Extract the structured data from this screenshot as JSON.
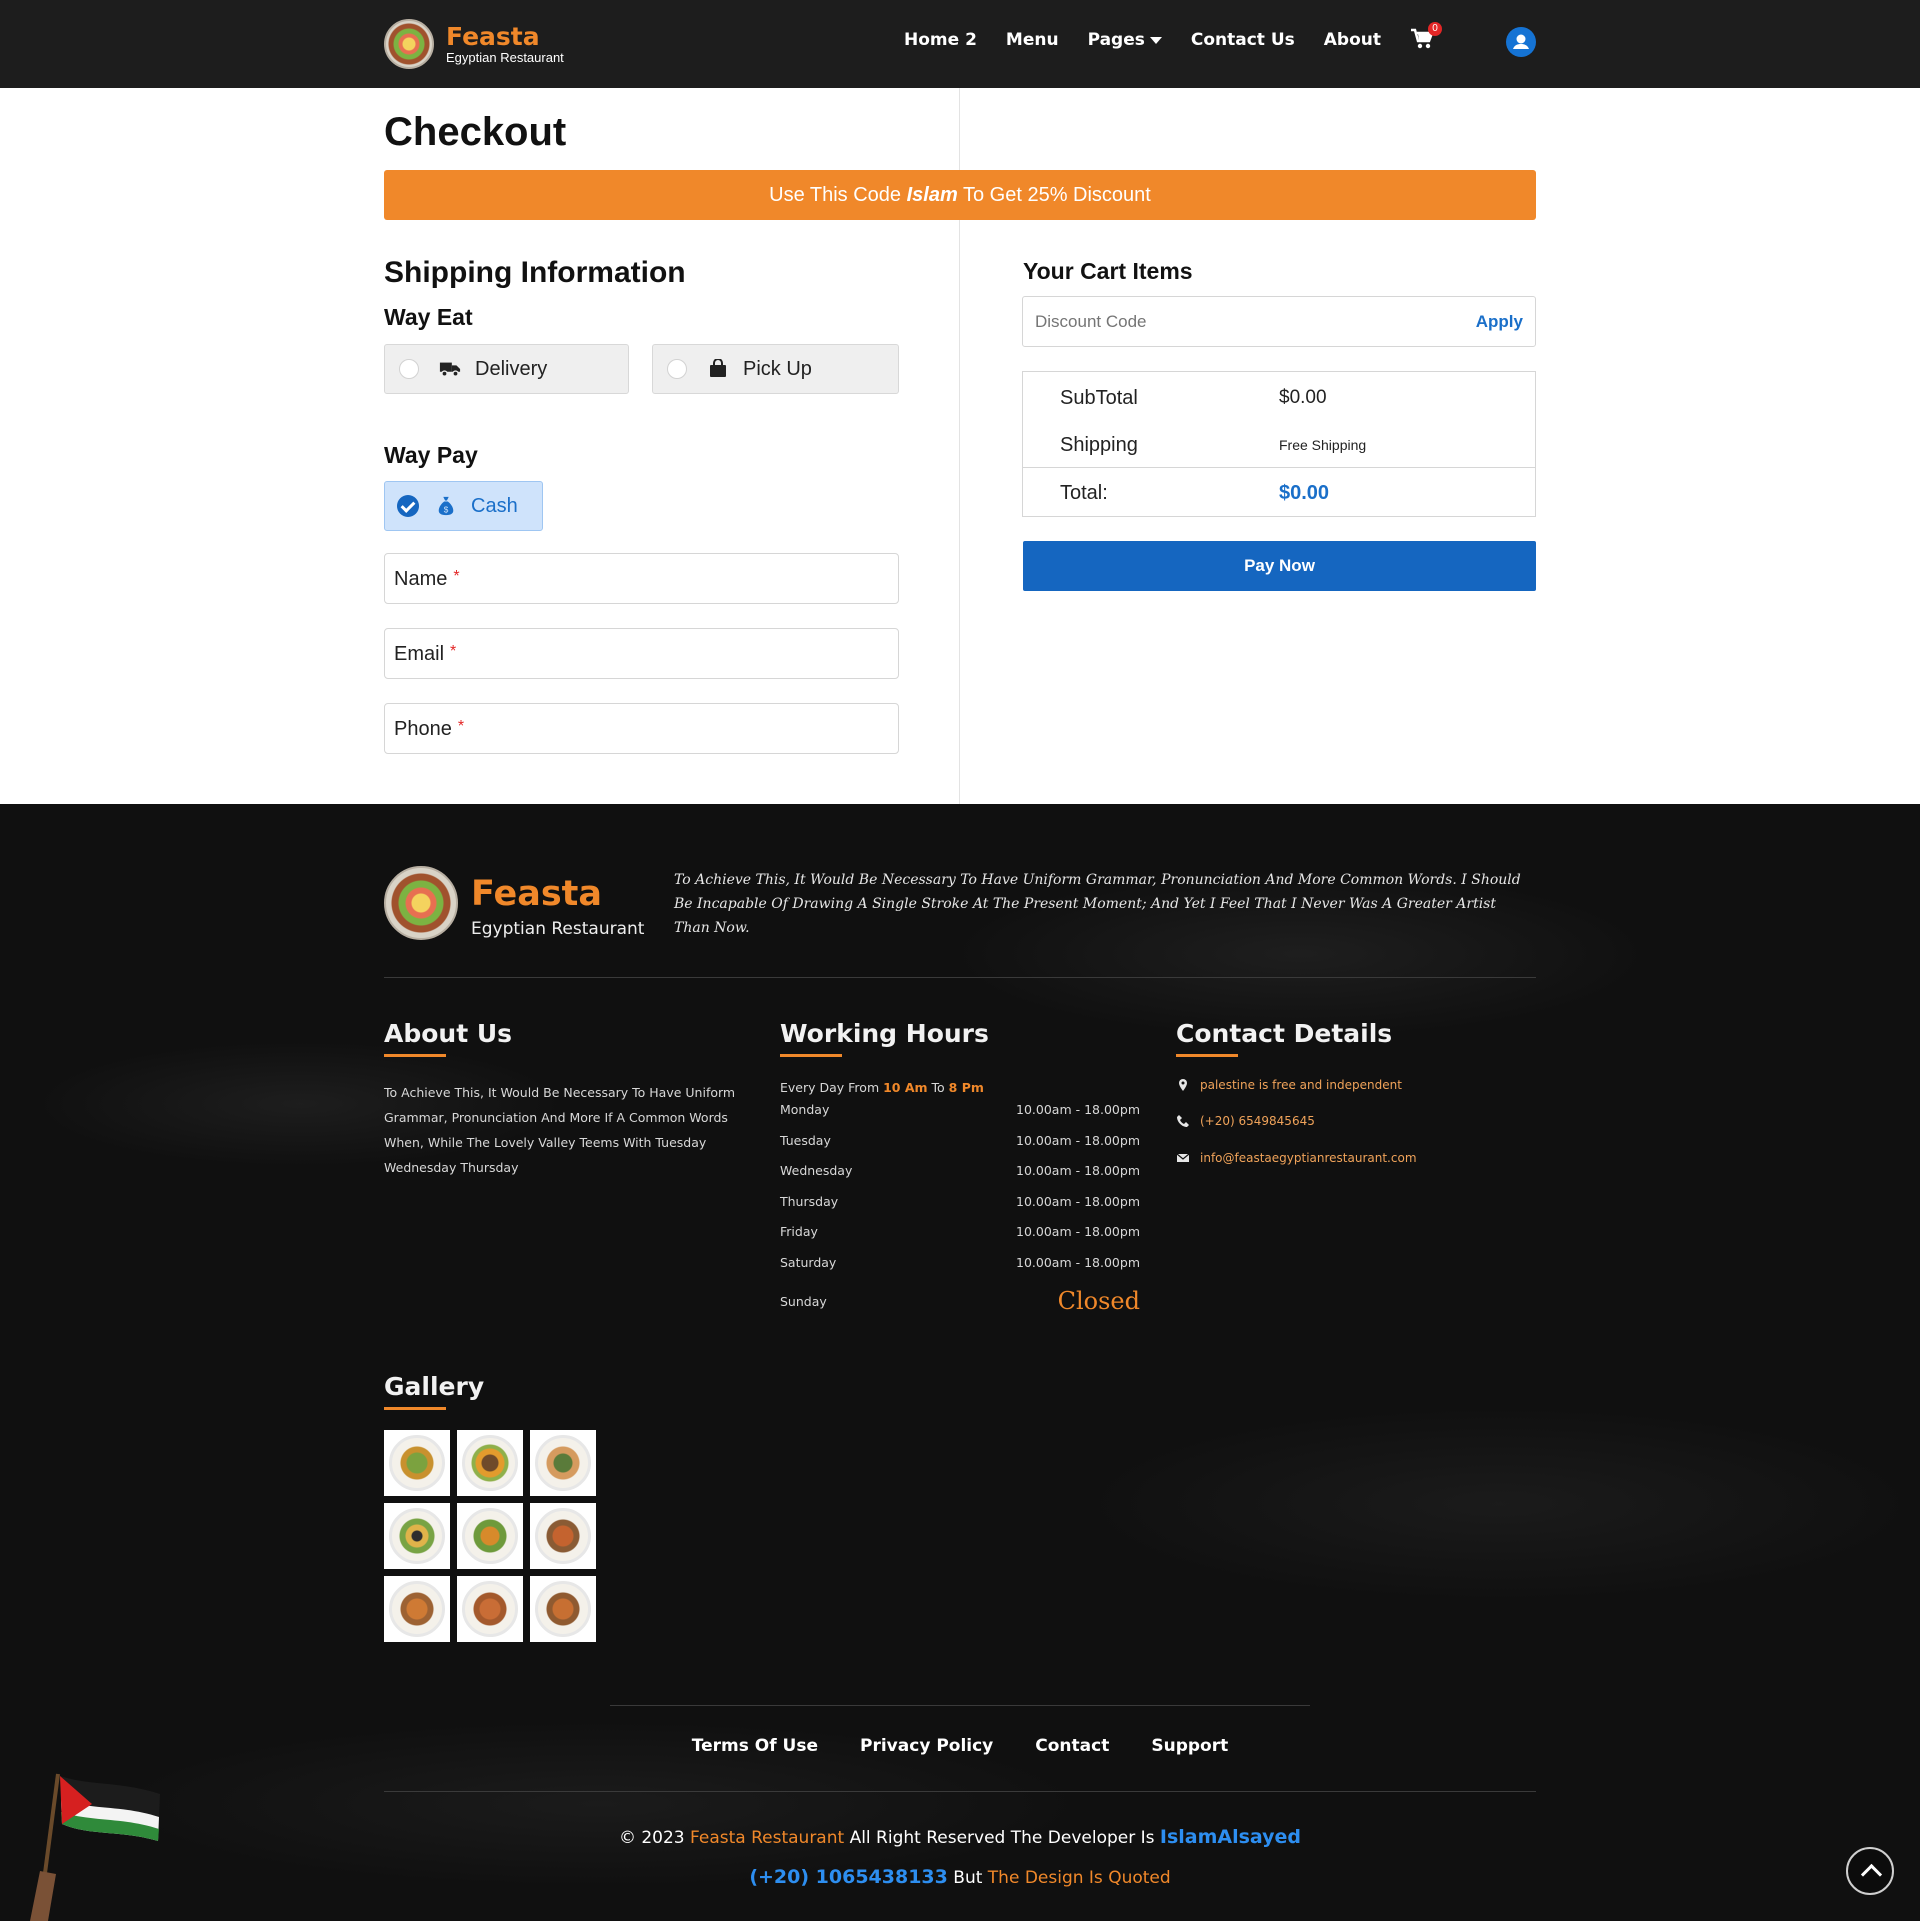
{
  "brand": {
    "name": "Feasta",
    "subtitle": "Egyptian Restaurant"
  },
  "nav": {
    "links": [
      "Home 2",
      "Menu",
      "Pages",
      "Contact Us",
      "About"
    ],
    "cart_count": "0"
  },
  "page": {
    "title": "Checkout",
    "promo": {
      "before": "Use This Code ",
      "code": "Islam",
      "after": " To Get 25% Discount"
    }
  },
  "shipping": {
    "heading": "Shipping Information",
    "way_eat_label": "Way Eat",
    "eat_options": [
      "Delivery",
      "Pick Up"
    ],
    "way_pay_label": "Way Pay",
    "pay_option": "Cash",
    "fields": [
      {
        "label": "Name",
        "required": "*"
      },
      {
        "label": "Email",
        "required": "*"
      },
      {
        "label": "Phone",
        "required": "*"
      }
    ]
  },
  "cart": {
    "title": "Your Cart Items",
    "discount_placeholder": "Discount Code",
    "apply_label": "Apply",
    "subtotal_label": "SubTotal",
    "subtotal_value": "$0.00",
    "shipping_label": "Shipping",
    "shipping_value": "Free Shipping",
    "total_label": "Total:",
    "total_value": "$0.00",
    "pay_label": "Pay Now"
  },
  "footer": {
    "brand_name": "Feasta",
    "brand_sub": "Egyptian Restaurant",
    "intro": "To Achieve This, It Would Be Necessary To Have Uniform Grammar, Pronunciation And More Common Words. I Should Be Incapable Of Drawing A Single Stroke At The Present Moment; And Yet I Feel That I Never Was A Greater Artist Than Now.",
    "about": {
      "heading": "About Us",
      "text": "To Achieve This, It Would Be Necessary To Have Uniform Grammar, Pronunciation And More If A Common Words When, While The Lovely Valley Teems With Tuesday Wednesday Thursday"
    },
    "hours": {
      "heading": "Working Hours",
      "summary_prefix": "Every Day From ",
      "from": "10 Am",
      "mid": " To ",
      "to": "8 Pm",
      "days": [
        {
          "day": "Monday",
          "time": "10.00am - 18.00pm"
        },
        {
          "day": "Tuesday",
          "time": "10.00am - 18.00pm"
        },
        {
          "day": "Wednesday",
          "time": "10.00am - 18.00pm"
        },
        {
          "day": "Thursday",
          "time": "10.00am - 18.00pm"
        },
        {
          "day": "Friday",
          "time": "10.00am - 18.00pm"
        },
        {
          "day": "Saturday",
          "time": "10.00am - 18.00pm"
        }
      ],
      "sunday": "Sunday",
      "sunday_status": "Closed"
    },
    "contact": {
      "heading": "Contact Details",
      "address": "palestine is free and independent",
      "phone": "(+20) 6549845645",
      "email": "info@feastaegyptianrestaurant.com"
    },
    "gallery": {
      "heading": "Gallery"
    },
    "links": [
      "Terms Of Use",
      "Privacy Policy",
      "Contact",
      "Support"
    ],
    "copyright": {
      "prefix": "© 2023 ",
      "restaurant": "Feasta Restaurant",
      "middle": " All Right Reserved The Developer Is ",
      "developer": "IslamAlsayed"
    },
    "phone_line": {
      "phone": "(+20) 1065438133",
      "middle": " But ",
      "quoted": "The Design Is Quoted"
    }
  }
}
